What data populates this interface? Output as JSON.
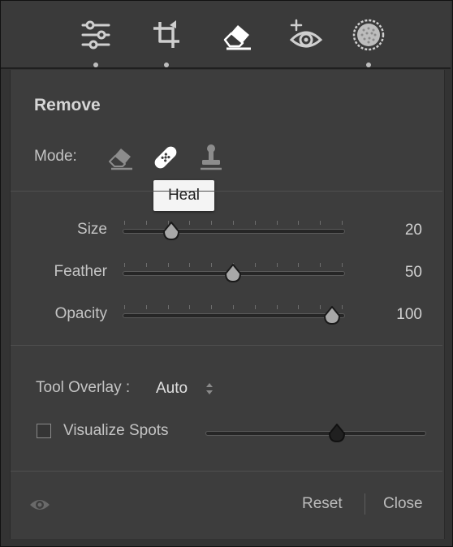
{
  "toolbar": {
    "tools": [
      {
        "name": "edit-sliders",
        "icon": "sliders-icon"
      },
      {
        "name": "crop",
        "icon": "crop-icon"
      },
      {
        "name": "remove",
        "icon": "eraser-icon",
        "active": true
      },
      {
        "name": "red-eye",
        "icon": "red-eye-icon"
      },
      {
        "name": "masking",
        "icon": "mask-circle-icon"
      }
    ]
  },
  "panel": {
    "title": "Remove",
    "mode_label": "Mode:",
    "modes": [
      {
        "name": "content-aware-remove",
        "icon": "eraser-icon"
      },
      {
        "name": "heal",
        "icon": "bandage-icon",
        "selected": true
      },
      {
        "name": "clone",
        "icon": "stamp-icon"
      }
    ],
    "tooltip": "Heal",
    "sliders": [
      {
        "label": "Size",
        "value": "20",
        "level": 0.22
      },
      {
        "label": "Feather",
        "value": "50",
        "level": 0.5
      },
      {
        "label": "Opacity",
        "value": "100",
        "level": 0.95
      }
    ],
    "tool_overlay_label": "Tool Overlay :",
    "tool_overlay_value": "Auto",
    "visualize_label": "Visualize Spots",
    "visualize_checked": false,
    "visualize_level": 0.6,
    "reset_label": "Reset",
    "close_label": "Close"
  },
  "colors": {
    "panel_bg": "#3d3d3d",
    "toolbar_bg": "#3a3a3a",
    "tooltip_bg": "#f4f4f4"
  }
}
